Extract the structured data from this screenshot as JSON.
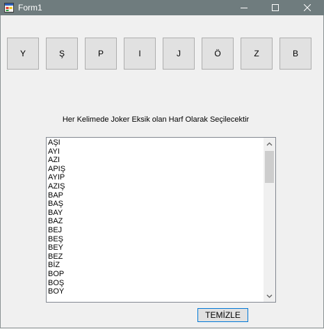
{
  "window": {
    "title": "Form1"
  },
  "letter_buttons": [
    "Y",
    "Ş",
    "P",
    "I",
    "J",
    "Ö",
    "Z",
    "B"
  ],
  "info_label": "Her Kelimede Joker Eksik olan Harf Olarak Seçilecektir",
  "word_list": [
    "AŞI",
    "AYI",
    "AZI",
    "APIŞ",
    "AYIP",
    "AZIŞ",
    "BAP",
    "BAŞ",
    "BAY",
    "BAZ",
    "BEJ",
    "BEŞ",
    "BEY",
    "BEZ",
    "BİZ",
    "BOP",
    "BOŞ",
    "BOY"
  ],
  "clear_button": "TEMİZLE",
  "colors": {
    "titlebar": "#6f7c7e",
    "button_face": "#e1e1e1",
    "focus_border": "#0078d7"
  }
}
